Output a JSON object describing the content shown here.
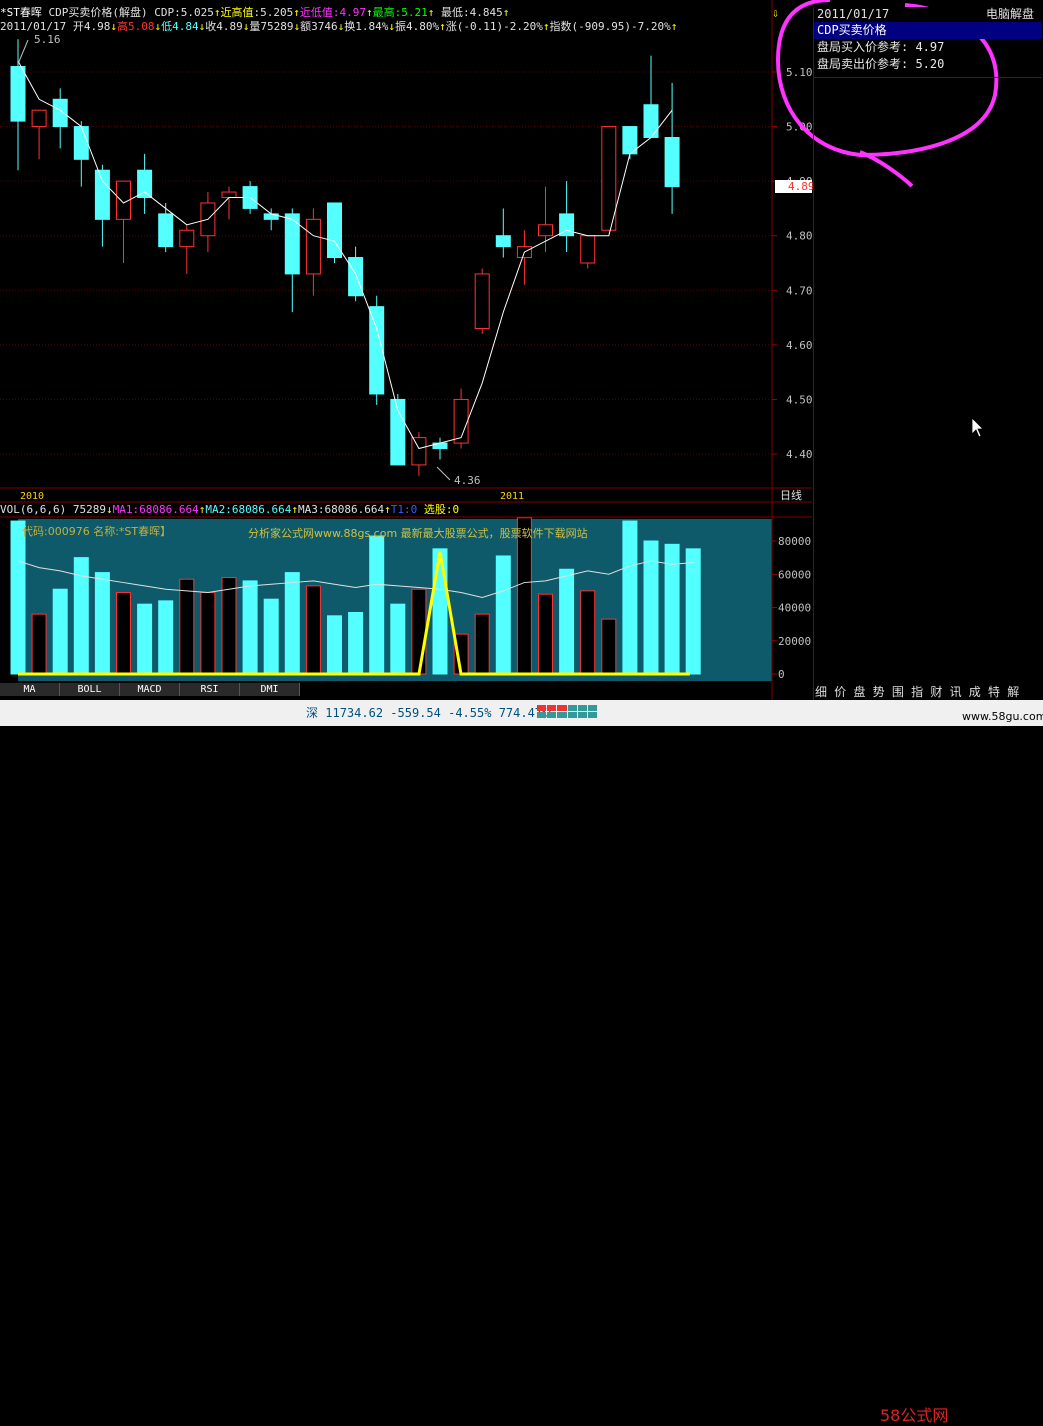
{
  "header": {
    "stock": "*ST春晖",
    "indicator": "CDP买卖价格(解盘)",
    "cdp": "CDP:5.025",
    "near_high_label": "近高值",
    "near_high": ":5.205",
    "near_low_label": "近低值",
    "near_low": ":4.97",
    "highest_label": "最高",
    "highest": ":5.21",
    "lowest": "最低:4.845",
    "line2_date": "2011/01/17",
    "open": "开4.98",
    "high": "高5.08",
    "low": "低4.84",
    "close": "收4.89",
    "vol": "量75289",
    "amount": "额3746",
    "turnover": "换1.84%",
    "amplitude": "振4.80%",
    "change": "涨(-0.11)-2.20%",
    "index": "指数(-909.95)-7.20%"
  },
  "chart_data": [
    {
      "type": "candlestick",
      "ylim": [
        4.35,
        5.16
      ],
      "y_ticks": [
        "5.10",
        "5.00",
        "4.90",
        "4.80",
        "4.70",
        "4.60",
        "4.50",
        "4.40"
      ],
      "x_labels": [
        "2010",
        "2011"
      ],
      "annotations": [
        "5.16",
        "4.36"
      ],
      "current_price": "4.89",
      "period": "日线",
      "candles": [
        {
          "o": 5.11,
          "h": 5.16,
          "l": 4.92,
          "c": 5.01
        },
        {
          "o": 5.0,
          "h": 5.02,
          "l": 4.94,
          "c": 5.03
        },
        {
          "o": 5.05,
          "h": 5.07,
          "l": 4.96,
          "c": 5.0
        },
        {
          "o": 5.0,
          "h": 5.01,
          "l": 4.89,
          "c": 4.94
        },
        {
          "o": 4.92,
          "h": 4.93,
          "l": 4.78,
          "c": 4.83
        },
        {
          "o": 4.83,
          "h": 4.9,
          "l": 4.75,
          "c": 4.9
        },
        {
          "o": 4.92,
          "h": 4.95,
          "l": 4.84,
          "c": 4.87
        },
        {
          "o": 4.84,
          "h": 4.86,
          "l": 4.77,
          "c": 4.78
        },
        {
          "o": 4.78,
          "h": 4.82,
          "l": 4.73,
          "c": 4.81
        },
        {
          "o": 4.8,
          "h": 4.88,
          "l": 4.77,
          "c": 4.86
        },
        {
          "o": 4.87,
          "h": 4.89,
          "l": 4.83,
          "c": 4.88
        },
        {
          "o": 4.89,
          "h": 4.9,
          "l": 4.84,
          "c": 4.85
        },
        {
          "o": 4.84,
          "h": 4.85,
          "l": 4.81,
          "c": 4.83
        },
        {
          "o": 4.84,
          "h": 4.85,
          "l": 4.66,
          "c": 4.73
        },
        {
          "o": 4.73,
          "h": 4.85,
          "l": 4.69,
          "c": 4.83
        },
        {
          "o": 4.86,
          "h": 4.86,
          "l": 4.75,
          "c": 4.76
        },
        {
          "o": 4.76,
          "h": 4.78,
          "l": 4.68,
          "c": 4.69
        },
        {
          "o": 4.67,
          "h": 4.69,
          "l": 4.49,
          "c": 4.51
        },
        {
          "o": 4.5,
          "h": 4.51,
          "l": 4.38,
          "c": 4.38
        },
        {
          "o": 4.38,
          "h": 4.44,
          "l": 4.36,
          "c": 4.43
        },
        {
          "o": 4.42,
          "h": 4.43,
          "l": 4.39,
          "c": 4.41
        },
        {
          "o": 4.42,
          "h": 4.52,
          "l": 4.41,
          "c": 4.5
        },
        {
          "o": 4.63,
          "h": 4.74,
          "l": 4.62,
          "c": 4.73
        },
        {
          "o": 4.8,
          "h": 4.85,
          "l": 4.76,
          "c": 4.78
        },
        {
          "o": 4.76,
          "h": 4.81,
          "l": 4.71,
          "c": 4.78
        },
        {
          "o": 4.8,
          "h": 4.89,
          "l": 4.77,
          "c": 4.82
        },
        {
          "o": 4.84,
          "h": 4.9,
          "l": 4.77,
          "c": 4.8
        },
        {
          "o": 4.75,
          "h": 4.8,
          "l": 4.74,
          "c": 4.8
        },
        {
          "o": 4.81,
          "h": 5.0,
          "l": 4.81,
          "c": 5.0
        },
        {
          "o": 5.0,
          "h": 5.0,
          "l": 4.94,
          "c": 4.95
        },
        {
          "o": 5.04,
          "h": 5.13,
          "l": 4.99,
          "c": 4.98
        },
        {
          "o": 4.98,
          "h": 5.08,
          "l": 4.84,
          "c": 4.89
        }
      ],
      "ma_line": [
        5.12,
        5.05,
        5.03,
        5.0,
        4.9,
        4.86,
        4.88,
        4.85,
        4.82,
        4.83,
        4.87,
        4.87,
        4.84,
        4.83,
        4.8,
        4.79,
        4.73,
        4.63,
        4.48,
        4.41,
        4.42,
        4.43,
        4.53,
        4.66,
        4.77,
        4.79,
        4.81,
        4.8,
        4.8,
        4.95,
        4.98,
        5.03
      ]
    },
    {
      "type": "bar",
      "title": "VOL(6,6,6)",
      "ylim": [
        0,
        95000
      ],
      "y_ticks": [
        "80000",
        "60000",
        "40000",
        "20000",
        "0"
      ],
      "values": [
        92000,
        36000,
        51000,
        70000,
        61000,
        49000,
        42000,
        44000,
        57000,
        49000,
        58000,
        56000,
        45000,
        61000,
        53000,
        35000,
        37000,
        83000,
        42000,
        51000,
        75289,
        24000,
        36000,
        71000,
        94000,
        48000,
        63000,
        50000,
        33000,
        92000,
        80000,
        78000,
        75289
      ],
      "ma_line": [
        68000,
        64000,
        62000,
        59000,
        57000,
        55000,
        53000,
        51000,
        50000,
        49000,
        51000,
        53000,
        54000,
        55000,
        56000,
        54000,
        52000,
        54000,
        53000,
        52000,
        51000,
        49000,
        46000,
        50000,
        55000,
        56000,
        59000,
        62000,
        60000,
        65000,
        68000,
        66000,
        67000
      ],
      "cdp_spike_index": 20
    }
  ],
  "vol_header": {
    "vol": "75289",
    "ma1": "MA1:68086.664",
    "ma2": "MA2:68086.664",
    "ma3": "MA3:68086.664",
    "t1": "T1:0",
    "select": "选股:0"
  },
  "vol_watermark": "代码:000976 名称:*ST春晖】",
  "vol_banner": "分析家公式网www.88gs.com 最新最大股票公式，股票软件下载网站",
  "side": {
    "date": "2011/01/17",
    "title": "电脑解盘",
    "item0": "CDP买卖价格",
    "item1": "盘局买入价参考: 4.97",
    "item2": "盘局卖出价参考: 5.20",
    "tabs": "细 价 盘 势 围 指 财 讯 成 特 解"
  },
  "tabs": [
    "MA",
    "BOLL",
    "MACD",
    "RSI",
    "DMI"
  ],
  "status": {
    "market": "深",
    "index": "11734.62",
    "change": "-559.54",
    "pct": "-4.55%",
    "amount": "774.47亿",
    "logo": "58公式网",
    "url": "www.58gu.com"
  },
  "colors": {
    "up": "#ff3232",
    "down": "#54ffff",
    "ma": "#ffffff",
    "spike": "#ffff00"
  }
}
